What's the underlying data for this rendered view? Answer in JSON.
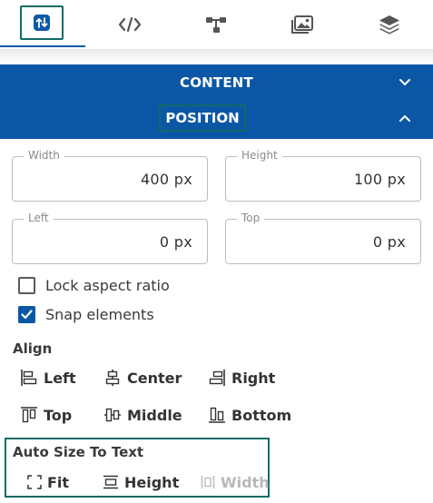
{
  "tabs": [
    {
      "name": "position-tab",
      "icon": "swap-vertical-icon",
      "active": true
    },
    {
      "name": "code-tab",
      "icon": "code-icon",
      "active": false
    },
    {
      "name": "hierarchy-tab",
      "icon": "hierarchy-icon",
      "active": false
    },
    {
      "name": "images-tab",
      "icon": "images-icon",
      "active": false
    },
    {
      "name": "layers-tab",
      "icon": "layers-icon",
      "active": false
    }
  ],
  "sections": {
    "content_label": "CONTENT",
    "position_label": "POSITION"
  },
  "fields": {
    "width": {
      "label": "Width",
      "value": "400 px"
    },
    "height": {
      "label": "Height",
      "value": "100 px"
    },
    "left": {
      "label": "Left",
      "value": "0 px"
    },
    "top": {
      "label": "Top",
      "value": "0 px"
    }
  },
  "options": {
    "lock_aspect": {
      "label": "Lock aspect ratio",
      "checked": false
    },
    "snap": {
      "label": "Snap elements",
      "checked": true
    }
  },
  "align": {
    "title": "Align",
    "left": "Left",
    "center": "Center",
    "right": "Right",
    "top": "Top",
    "middle": "Middle",
    "bottom": "Bottom"
  },
  "autosize": {
    "title": "Auto Size To Text",
    "fit": "Fit",
    "height": "Height",
    "width": "Width",
    "width_disabled": true
  },
  "colors": {
    "accent": "#0b57a6",
    "highlight_border": "#0f6b66"
  }
}
